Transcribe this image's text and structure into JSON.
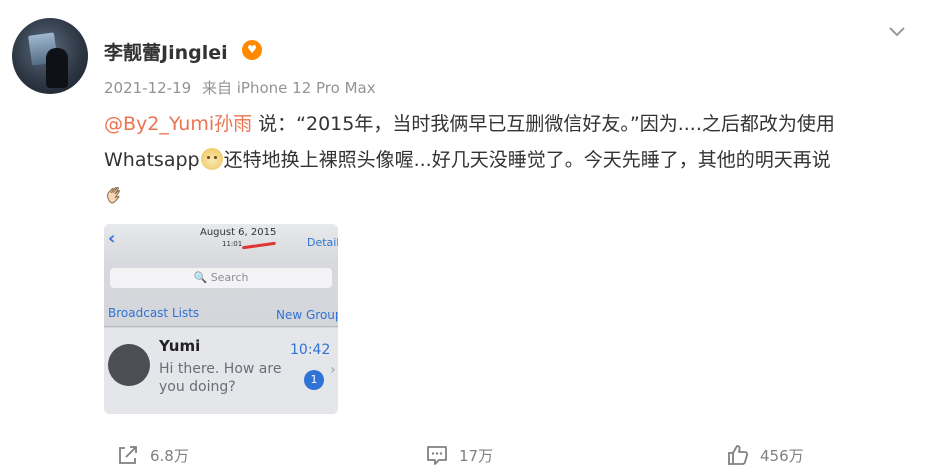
{
  "post": {
    "author": "李靓蕾Jinglei",
    "date": "2021-12-19",
    "source_prefix": "来自",
    "source_device": "iPhone 12 Pro Max",
    "mention": "@By2_Yumi孙雨",
    "text_part1": " 说：“2015年，当时我俩早已互删微信好友。”因为....之后都改为使用Whatsapp",
    "text_part2": "还特地换上裸照头像喔...好几天没睡觉了。今天先睡了，其他的明天再说",
    "accent_color": "#eb7350"
  },
  "photo": {
    "date": "August 6, 2015",
    "time": "11:01",
    "details": "Details",
    "search": "🔍 Search",
    "broadcast": "Broadcast Lists",
    "new_group": "New Group",
    "contact_name": "Yumi",
    "message": "Hi there. How are you doing?",
    "msg_time": "10:42",
    "unread": "1"
  },
  "actions": {
    "share_count": "6.8万",
    "comment_count": "17万",
    "like_count": "456万"
  }
}
